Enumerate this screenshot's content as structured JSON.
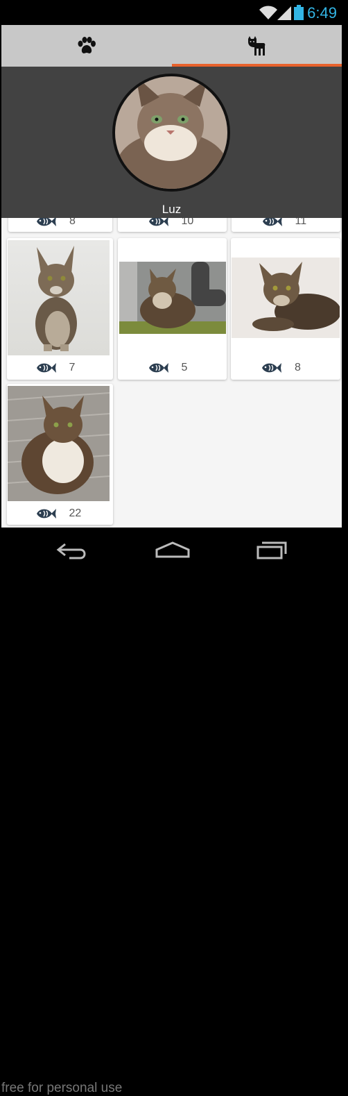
{
  "status_bar": {
    "time": "6:49"
  },
  "tabs": [
    {
      "icon": "paw-icon",
      "active": false
    },
    {
      "icon": "cat-icon",
      "active": true
    }
  ],
  "profile": {
    "name": "Luz"
  },
  "cards_top_row": [
    {
      "count": "8"
    },
    {
      "count": "10"
    },
    {
      "count": "11"
    }
  ],
  "cards": [
    {
      "count": "7"
    },
    {
      "count": "5"
    },
    {
      "count": "8"
    },
    {
      "count": "22"
    }
  ],
  "watermark": "free for personal use",
  "colors": {
    "accent": "#e8622c",
    "header": "#424242",
    "icon": "#2c3e50",
    "clock": "#33b5e5"
  }
}
